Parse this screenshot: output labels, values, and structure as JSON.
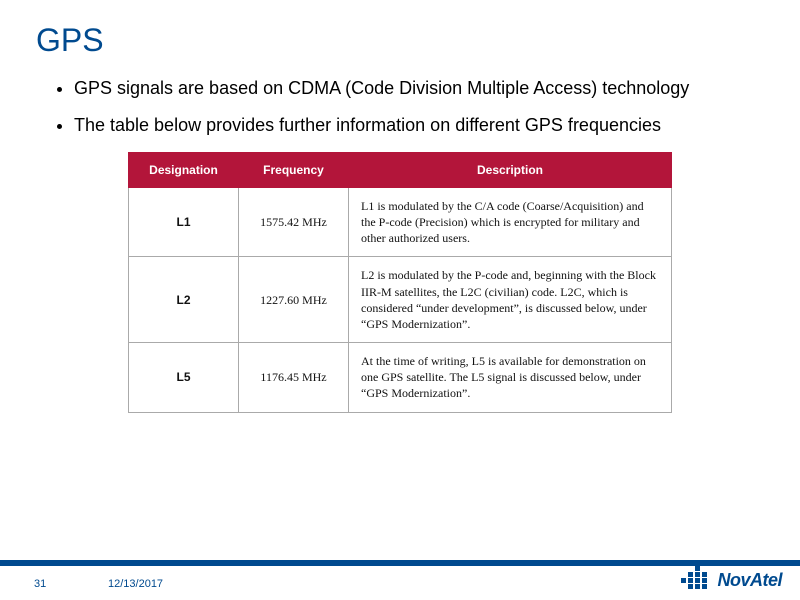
{
  "title": "GPS",
  "bullets": [
    "GPS signals are based on CDMA (Code Division Multiple Access) technology",
    "The table below provides further information on different GPS frequencies"
  ],
  "table": {
    "headers": [
      "Designation",
      "Frequency",
      "Description"
    ],
    "rows": [
      {
        "designation": "L1",
        "frequency": "1575.42 MHz",
        "description": "L1 is modulated by the C/A code (Coarse/Acquisition) and the P-code (Precision) which is encrypted for military and other authorized users."
      },
      {
        "designation": "L2",
        "frequency": "1227.60 MHz",
        "description": "L2 is modulated by the P-code and, beginning with the Block IIR-M satellites, the L2C (civilian) code. L2C, which is considered “under development”, is discussed below, under “GPS Modernization”."
      },
      {
        "designation": "L5",
        "frequency": "1176.45 MHz",
        "description": "At the time of writing, L5 is available for demonstration on one GPS satellite. The L5 signal is discussed below, under “GPS Modernization”."
      }
    ]
  },
  "footer": {
    "page": "31",
    "date": "12/13/2017",
    "logo_text": "NovAtel"
  }
}
